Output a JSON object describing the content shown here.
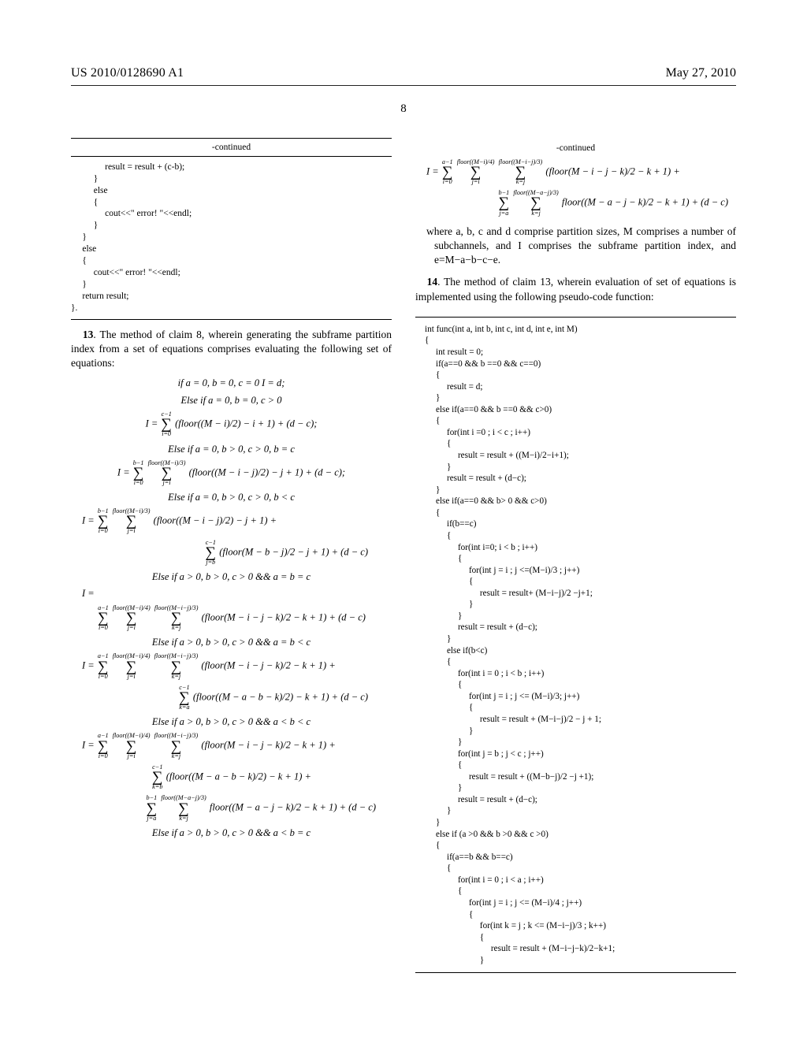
{
  "header": {
    "pub_number": "US 2010/0128690 A1",
    "pub_date": "May 27, 2010",
    "page_number": "8"
  },
  "left": {
    "continued_label": "-continued",
    "code_snippet": "               result = result + (c-b);\n          }\n          else\n          {\n               cout<<\" error! \"<<endl;\n          }\n     }\n     else\n     {\n          cout<<\" error! \"<<endl;\n     }\n     return result;\n}.",
    "claim13_lead": "13",
    "claim13_text": ". The method of claim 8, wherein generating the subframe partition index from a set of equations comprises evaluating the following set of equations:",
    "eq_line1": "if a = 0, b = 0, c = 0  I = d;",
    "eq_label2": "Else if a = 0, b = 0, c > 0",
    "eq2_sum_top": "c−1",
    "eq2_sum_bot": "i=0",
    "eq2_body": "(floor((M − i)/2) − i + 1) + (d − c);",
    "eq_label3": "Else if a = 0, b > 0, c > 0, b = c",
    "eq3_s1_top": "b−1",
    "eq3_s1_bot": "i=0",
    "eq3_s2_top": "floor((M−i)/3)",
    "eq3_s2_bot": "j=i",
    "eq3_body": "(floor((M − i − j)/2) − j + 1) + (d − c);",
    "eq_label4": "Else if a = 0, b > 0, c > 0, b < c",
    "eq4_s1_top": "b−1",
    "eq4_s1_bot": "i=0",
    "eq4_s2_top": "floor((M−i)/3)",
    "eq4_s2_bot": "j=i",
    "eq4_body1": "(floor((M − i − j)/2) − j + 1) +",
    "eq4_s3_top": "c−1",
    "eq4_s3_bot": "j=b",
    "eq4_body2": "(floor(M − b − j)/2 − j + 1) + (d − c)",
    "eq_label5": "Else if a > 0, b > 0, c > 0 && a = b = c",
    "eq5_pre": "I =",
    "eq5_s1_top": "a−1",
    "eq5_s1_bot": "i=0",
    "eq5_s2_top": "floor((M−i)/4)",
    "eq5_s2_bot": "j=i",
    "eq5_s3_top": "floor((M−i−j)/3)",
    "eq5_s3_bot": "k=j",
    "eq5_body": "(floor(M − i − j − k)/2 − k + 1) + (d − c)",
    "eq_label6": "Else if a > 0, b > 0, c > 0 && a = b < c",
    "eq6_body1": "(floor(M − i − j − k)/2 − k + 1) +",
    "eq6_s4_top": "c−1",
    "eq6_s4_bot": "k=a",
    "eq6_body2": "(floor((M − a − b − k)/2) − k + 1) + (d − c)",
    "eq_label7": "Else if a > 0, b > 0, c > 0 && a < b < c",
    "eq7_body1": "(floor(M − i − j − k)/2 − k + 1) +",
    "eq7_s4_top": "c−1",
    "eq7_s4_bot": "k=b",
    "eq7_body2": "(floor((M − a − b − k)/2) − k + 1) +",
    "eq7_s5_top": "b−1",
    "eq7_s5_bot": "j=a",
    "eq7_s6_top": "floor((M−a−j)/3)",
    "eq7_s6_bot": "k=j",
    "eq7_body3": "floor((M − a − j − k)/2 − k + 1) + (d − c)",
    "eq_label8": "Else if a > 0, b > 0, c > 0 && a < b = c"
  },
  "right": {
    "continued_label": "-continued",
    "eqR_s1_top": "a−1",
    "eqR_s1_bot": "i=0",
    "eqR_s2_top": "floor((M−i)/4)",
    "eqR_s2_bot": "j=i",
    "eqR_s3_top": "floor((M−i−j)/3)",
    "eqR_s3_bot": "k=j",
    "eqR_body1": "(floor(M − i − j − k)/2 − k + 1) +",
    "eqR_s4_top": "b−1",
    "eqR_s4_bot": "j=a",
    "eqR_s5_top": "floor((M−a−j)/3)",
    "eqR_s5_bot": "k=j",
    "eqR_body2": "floor((M − a − j − k)/2 − k + 1) + (d − c)",
    "where_text": "where a, b, c and d comprise partition sizes, M comprises a number of subchannels, and I comprises the subframe partition index, and e=M−a−b−c−e.",
    "claim14_lead": "14",
    "claim14_text": ". The method of claim 13, wherein evaluation of set of equations is implemented using the following pseudo-code function:",
    "code2": "int func(int a, int b, int c, int d, int e, int M)\n{\n     int result = 0;\n     if(a==0 && b ==0 && c==0)\n     {\n          result = d;\n     }\n     else if(a==0 && b ==0 && c>0)\n     {\n          for(int i =0 ; i < c ; i++)\n          {\n               result = result + ((M−i)/2−i+1);\n          }\n          result = result + (d−c);\n     }\n     else if(a==0 && b> 0 && c>0)\n     {\n          if(b==c)\n          {\n               for(int i=0; i < b ; i++)\n               {\n                    for(int j = i ; j <=(M−i)/3 ; j++)\n                    {\n                         result = result+ (M−i−j)/2 −j+1;\n                    }\n               }\n               result = result + (d−c);\n          }\n          else if(b<c)\n          {\n               for(int i = 0 ; i < b ; i++)\n               {\n                    for(int j = i ; j <= (M−i)/3; j++)\n                    {\n                         result = result + (M−i−j)/2 − j + 1;\n                    }\n               }\n               for(int j = b ; j < c ; j++)\n               {\n                    result = result + ((M−b−j)/2 −j +1);\n               }\n               result = result + (d−c);\n          }\n     }\n     else if (a >0 && b >0 && c >0)\n     {\n          if(a==b && b==c)\n          {\n               for(int i = 0 ; i < a ; i++)\n               {\n                    for(int j = i ; j <= (M−i)/4 ; j++)\n                    {\n                         for(int k = j ; k <= (M−i−j)/3 ; k++)\n                         {\n                              result = result + (M−i−j−k)/2−k+1;\n                         }"
  }
}
